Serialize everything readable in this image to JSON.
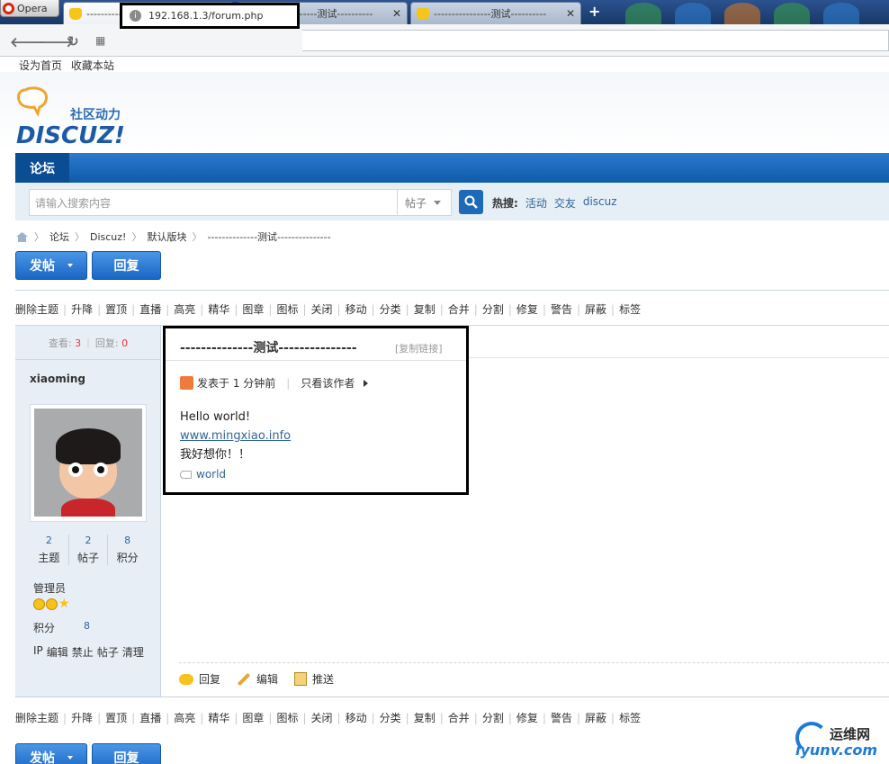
{
  "browser": {
    "menu_label": "Opera",
    "tabs": [
      {
        "title": "--------------测试---------"
      },
      {
        "title": "----------------测试----------"
      },
      {
        "title": "----------------测试----------"
      }
    ],
    "address": "192.168.1.3/forum.php"
  },
  "toplinks": [
    "设为首页",
    "收藏本站"
  ],
  "logo": {
    "tagline": "社区动力",
    "wordmark": "DISCUZ!"
  },
  "nav": {
    "current": "论坛"
  },
  "search": {
    "placeholder": "请输入搜索内容",
    "scope": "帖子",
    "hot_label": "热搜:",
    "hot_terms": [
      "活动",
      "交友",
      "discuz"
    ]
  },
  "breadcrumb": [
    "论坛",
    "Discuz!",
    "默认版块",
    "--------------测试---------------"
  ],
  "buttons": {
    "post": "发帖",
    "reply": "回复"
  },
  "mod_tools": [
    "删除主题",
    "升降",
    "置顶",
    "直播",
    "高亮",
    "精华",
    "图章",
    "图标",
    "关闭",
    "移动",
    "分类",
    "复制",
    "合并",
    "分割",
    "修复",
    "警告",
    "屏蔽",
    "标签"
  ],
  "thread": {
    "views_label": "查看:",
    "views": "3",
    "replies_label": "回复:",
    "replies": "0",
    "title": "--------------测试---------------",
    "copy_link": "[复制链接]"
  },
  "author": {
    "name": "xiaoming",
    "counts": [
      {
        "value": "2",
        "label": "主题"
      },
      {
        "value": "2",
        "label": "帖子"
      },
      {
        "value": "8",
        "label": "积分"
      }
    ],
    "group": "管理员",
    "credit_label": "积分",
    "credit_value": "8",
    "admin_tools": [
      "IP",
      "编辑",
      "禁止",
      "帖子",
      "清理"
    ]
  },
  "post": {
    "posted_at": "发表于 1 分钟前",
    "only_author": "只看该作者",
    "lines": [
      "Hello world!",
      "www.mingxiao.info",
      "我好想你！！"
    ],
    "tag": "world",
    "actions": [
      "回复",
      "编辑",
      "推送"
    ]
  },
  "watermark": {
    "cn": "运维网",
    "en": "iyunv.com"
  }
}
